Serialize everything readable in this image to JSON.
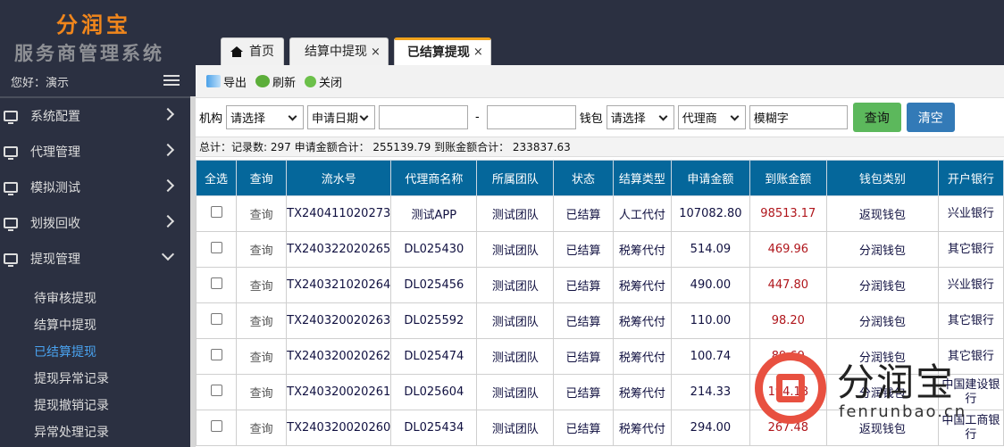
{
  "brand": {
    "name": "分润宝",
    "subtitle": "服务商管理系统"
  },
  "user": {
    "greeting": "您好：演示"
  },
  "sidebar": {
    "items": [
      {
        "label": "系统配置"
      },
      {
        "label": "代理管理"
      },
      {
        "label": "模拟测试"
      },
      {
        "label": "划拨回收"
      },
      {
        "label": "提现管理"
      }
    ],
    "subitems": [
      {
        "label": "待审核提现"
      },
      {
        "label": "结算中提现"
      },
      {
        "label": "已结算提现",
        "active": true
      },
      {
        "label": "提现异常记录"
      },
      {
        "label": "提现撤销记录"
      },
      {
        "label": "异常处理记录"
      }
    ]
  },
  "tabs": [
    {
      "label": "首页"
    },
    {
      "label": "结算中提现",
      "close": "×"
    },
    {
      "label": "已结算提现",
      "close": "×"
    }
  ],
  "toolbar": {
    "export": "导出",
    "refresh": "刷新",
    "close": "关闭"
  },
  "filters": {
    "org_label": "机构",
    "org_value": "请选择",
    "date_type": "申请日期",
    "date_sep": "-",
    "wallet_label": "钱包",
    "wallet_value": "请选择",
    "agent_value": "代理商",
    "keyword_placeholder": "模糊字",
    "search": "查询",
    "clear": "清空"
  },
  "summary": {
    "text": "总计：记录数: 297 申请金额合计： 255139.79 到账金额合计： 233837.63"
  },
  "table": {
    "headers": [
      "全选",
      "查询",
      "流水号",
      "代理商名称",
      "所属团队",
      "状态",
      "结算类型",
      "申请金额",
      "到账金额",
      "钱包类别",
      "开户银行"
    ],
    "rows": [
      {
        "action": "查询",
        "serial": "TX240411020273",
        "agent": "测试APP",
        "team": "测试团队",
        "status": "已结算",
        "type": "人工代付",
        "apply": "107082.80",
        "arrive": "98513.17",
        "wallet": "返现钱包",
        "bank": "兴业银行"
      },
      {
        "action": "查询",
        "serial": "TX240322020265",
        "agent": "DL025430",
        "team": "测试团队",
        "status": "已结算",
        "type": "税筹代付",
        "apply": "514.09",
        "arrive": "469.96",
        "wallet": "分润钱包",
        "bank": "其它银行"
      },
      {
        "action": "查询",
        "serial": "TX240321020264",
        "agent": "DL025456",
        "team": "测试团队",
        "status": "已结算",
        "type": "税筹代付",
        "apply": "490.00",
        "arrive": "447.80",
        "wallet": "分润钱包",
        "bank": "兴业银行"
      },
      {
        "action": "查询",
        "serial": "TX240320020263",
        "agent": "DL025592",
        "team": "测试团队",
        "status": "已结算",
        "type": "税筹代付",
        "apply": "110.00",
        "arrive": "98.20",
        "wallet": "分润钱包",
        "bank": "其它银行"
      },
      {
        "action": "查询",
        "serial": "TX240320020262",
        "agent": "DL025474",
        "team": "测试团队",
        "status": "已结算",
        "type": "税筹代付",
        "apply": "100.74",
        "arrive": "89.69",
        "wallet": "分润钱包",
        "bank": "其它银行"
      },
      {
        "action": "查询",
        "serial": "TX240320020261",
        "agent": "DL025604",
        "team": "测试团队",
        "status": "已结算",
        "type": "税筹代付",
        "apply": "214.33",
        "arrive": "194.18",
        "wallet": "分润钱包",
        "bank": "中国建设银行"
      },
      {
        "action": "查询",
        "serial": "TX240320020260",
        "agent": "DL025434",
        "team": "测试团队",
        "status": "已结算",
        "type": "税筹代付",
        "apply": "294.00",
        "arrive": "267.48",
        "wallet": "返现钱包",
        "bank": "中国工商银行"
      }
    ]
  },
  "watermark": {
    "name": "分润宝",
    "url": "fenrunbao.cn"
  }
}
